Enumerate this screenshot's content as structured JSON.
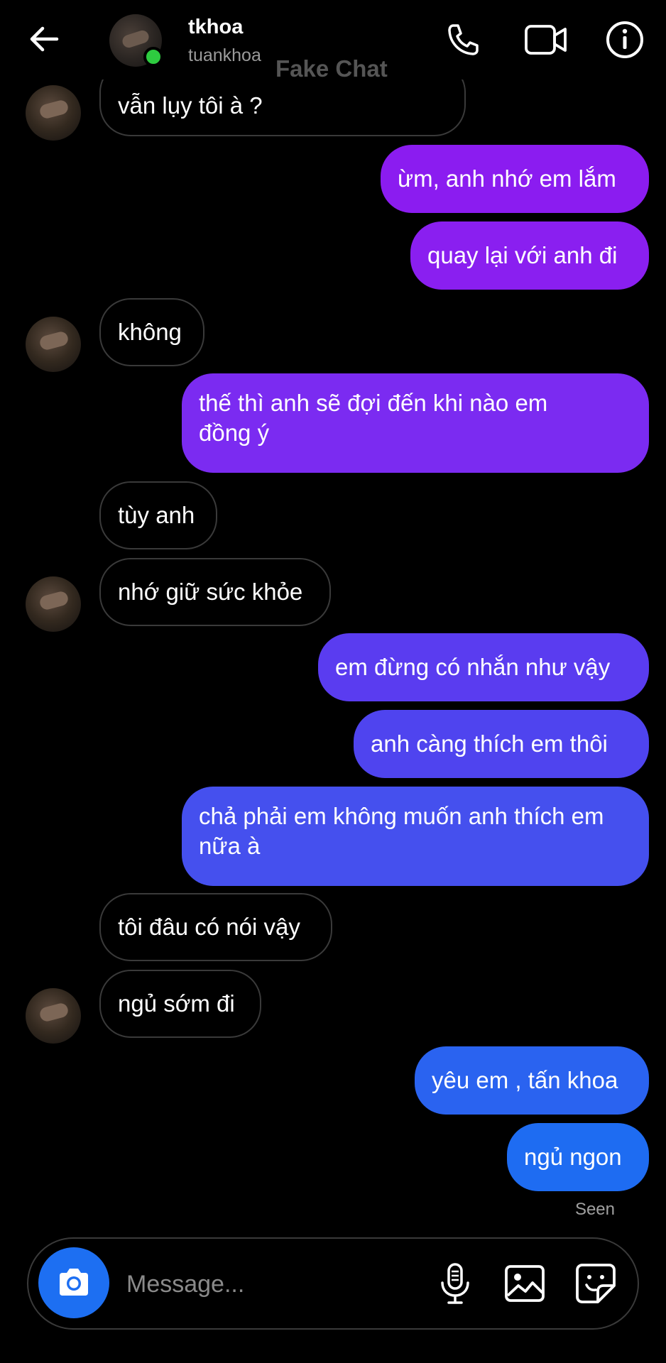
{
  "header": {
    "name": "tkhoa",
    "username": "tuankhoa",
    "watermark": "Fake Chat"
  },
  "messages": [
    {
      "side": "in",
      "text": "vẫn lụy tôi à ?"
    },
    {
      "side": "out",
      "text": "ừm, anh nhớ em lắm",
      "color": "#8b1cf0"
    },
    {
      "side": "out",
      "text": "quay lại với anh đi",
      "color": "#8a1ff0"
    },
    {
      "side": "in",
      "text": "không"
    },
    {
      "side": "out",
      "text": "thế thì anh sẽ đợi đến khi nào em đồng ý",
      "color": "#7b2bf1"
    },
    {
      "side": "in",
      "text": "tùy anh"
    },
    {
      "side": "in",
      "text": "nhớ giữ sức khỏe"
    },
    {
      "side": "out",
      "text": "em đừng có nhắn như vậy",
      "color": "#5a3cf0"
    },
    {
      "side": "out",
      "text": "anh càng thích em thôi",
      "color": "#4f44ef"
    },
    {
      "side": "out",
      "text": "chả phải em không muốn anh thích em nữa à",
      "color": "#4550ee"
    },
    {
      "side": "in",
      "text": "tôi đâu có nói vậy"
    },
    {
      "side": "in",
      "text": "ngủ sớm đi"
    },
    {
      "side": "out",
      "text": "yêu em , tấn khoa",
      "color": "#2a63f0"
    },
    {
      "side": "out",
      "text": "ngủ ngon",
      "color": "#1e6cf2"
    }
  ],
  "seen_label": "Seen",
  "composer": {
    "placeholder": "Message..."
  },
  "colors": {
    "camera_button": "#1d6ff2",
    "online_dot": "#2ecc40"
  },
  "icons": [
    "back-arrow-icon",
    "phone-icon",
    "video-icon",
    "info-icon",
    "camera-icon",
    "microphone-icon",
    "image-icon",
    "sticker-icon"
  ]
}
